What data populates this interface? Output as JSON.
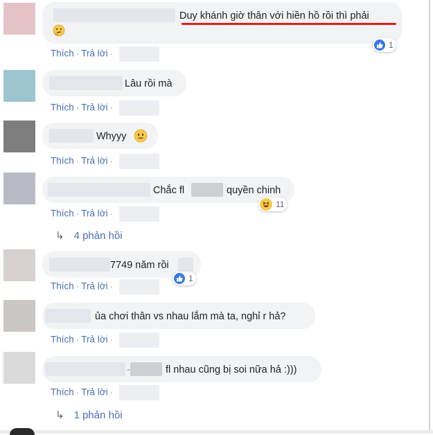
{
  "action_labels": {
    "like": "Thích",
    "reply": "Trả lời",
    "separator": "·"
  },
  "reply_arrow": "↳",
  "colors": {
    "link": "#4b6fb2",
    "bubble": "#f2f3f5",
    "underline": "#e41e1e",
    "like_blue": "#3b78e7",
    "haha_yellow": "#f7c94b"
  },
  "comments": [
    {
      "avatar_color": "#e3c3c6",
      "text": "Duy khánh giờ thân với hiền hồ rồi thì phải",
      "emoji": "thinking-face-icon",
      "reaction": {
        "type": "like",
        "count": "1"
      }
    },
    {
      "avatar_color": "#9dc5d1",
      "text": "Lâu rồi mà"
    },
    {
      "avatar_color": "#7d7d7d",
      "text": "Whyyy",
      "emoji": "smiling-face-icon"
    },
    {
      "avatar_color": "#b8bbc3",
      "text_1": "Chắc fl",
      "text_2": "quyền chinh",
      "reaction": {
        "type": "haha",
        "count": "11"
      },
      "replies": "4 phản hồi"
    },
    {
      "avatar_color": "#d6d0d0",
      "text": "7749 năm rồi",
      "reaction": {
        "type": "like",
        "count": "1"
      }
    },
    {
      "avatar_color": "#cac6c4",
      "text": "ủa chơi thân vs nhau lắm mà ta, nghỉ r hả?"
    },
    {
      "avatar_color": "#dadada",
      "text_prefix": "-",
      "text": "fl nhau cũng bị soi nữa hả :)))",
      "replies": "1 phản hồi"
    }
  ]
}
